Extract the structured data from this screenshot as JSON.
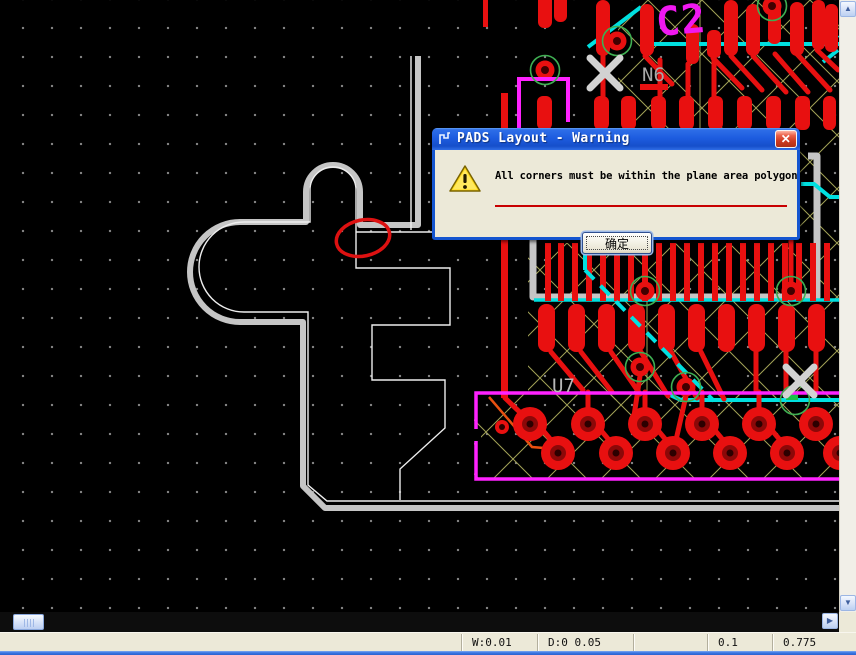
{
  "dialog": {
    "title": "PADS Layout - Warning",
    "message": "All corners must be within the plane area polygon",
    "ok_label": "确定",
    "close_glyph": "✕"
  },
  "canvas": {
    "ref_labels": {
      "c2": "C2",
      "n6": "N6",
      "u7": "U7"
    },
    "colors": {
      "background": "#000000",
      "copper_red": "#e81010",
      "trace_cyan": "#00e0e0",
      "silkscreen_magenta": "#ff22ff",
      "board_outline_gray": "#c5c5c5",
      "plane_polygon_white": "#eeeeee",
      "hatch_olive": "#a2a256",
      "via_ring_green": "#3fae52",
      "error_marker_red": "#dd1111"
    }
  },
  "status_bar": {
    "fields": [
      {
        "label": "W:0.01"
      },
      {
        "label": "D:0 0.05"
      },
      {
        "label": ""
      },
      {
        "label": "0.1"
      },
      {
        "label": "0.775"
      }
    ]
  },
  "scrollbars": {
    "up_glyph": "▲",
    "down_glyph": "▼",
    "right_glyph": "▶"
  }
}
